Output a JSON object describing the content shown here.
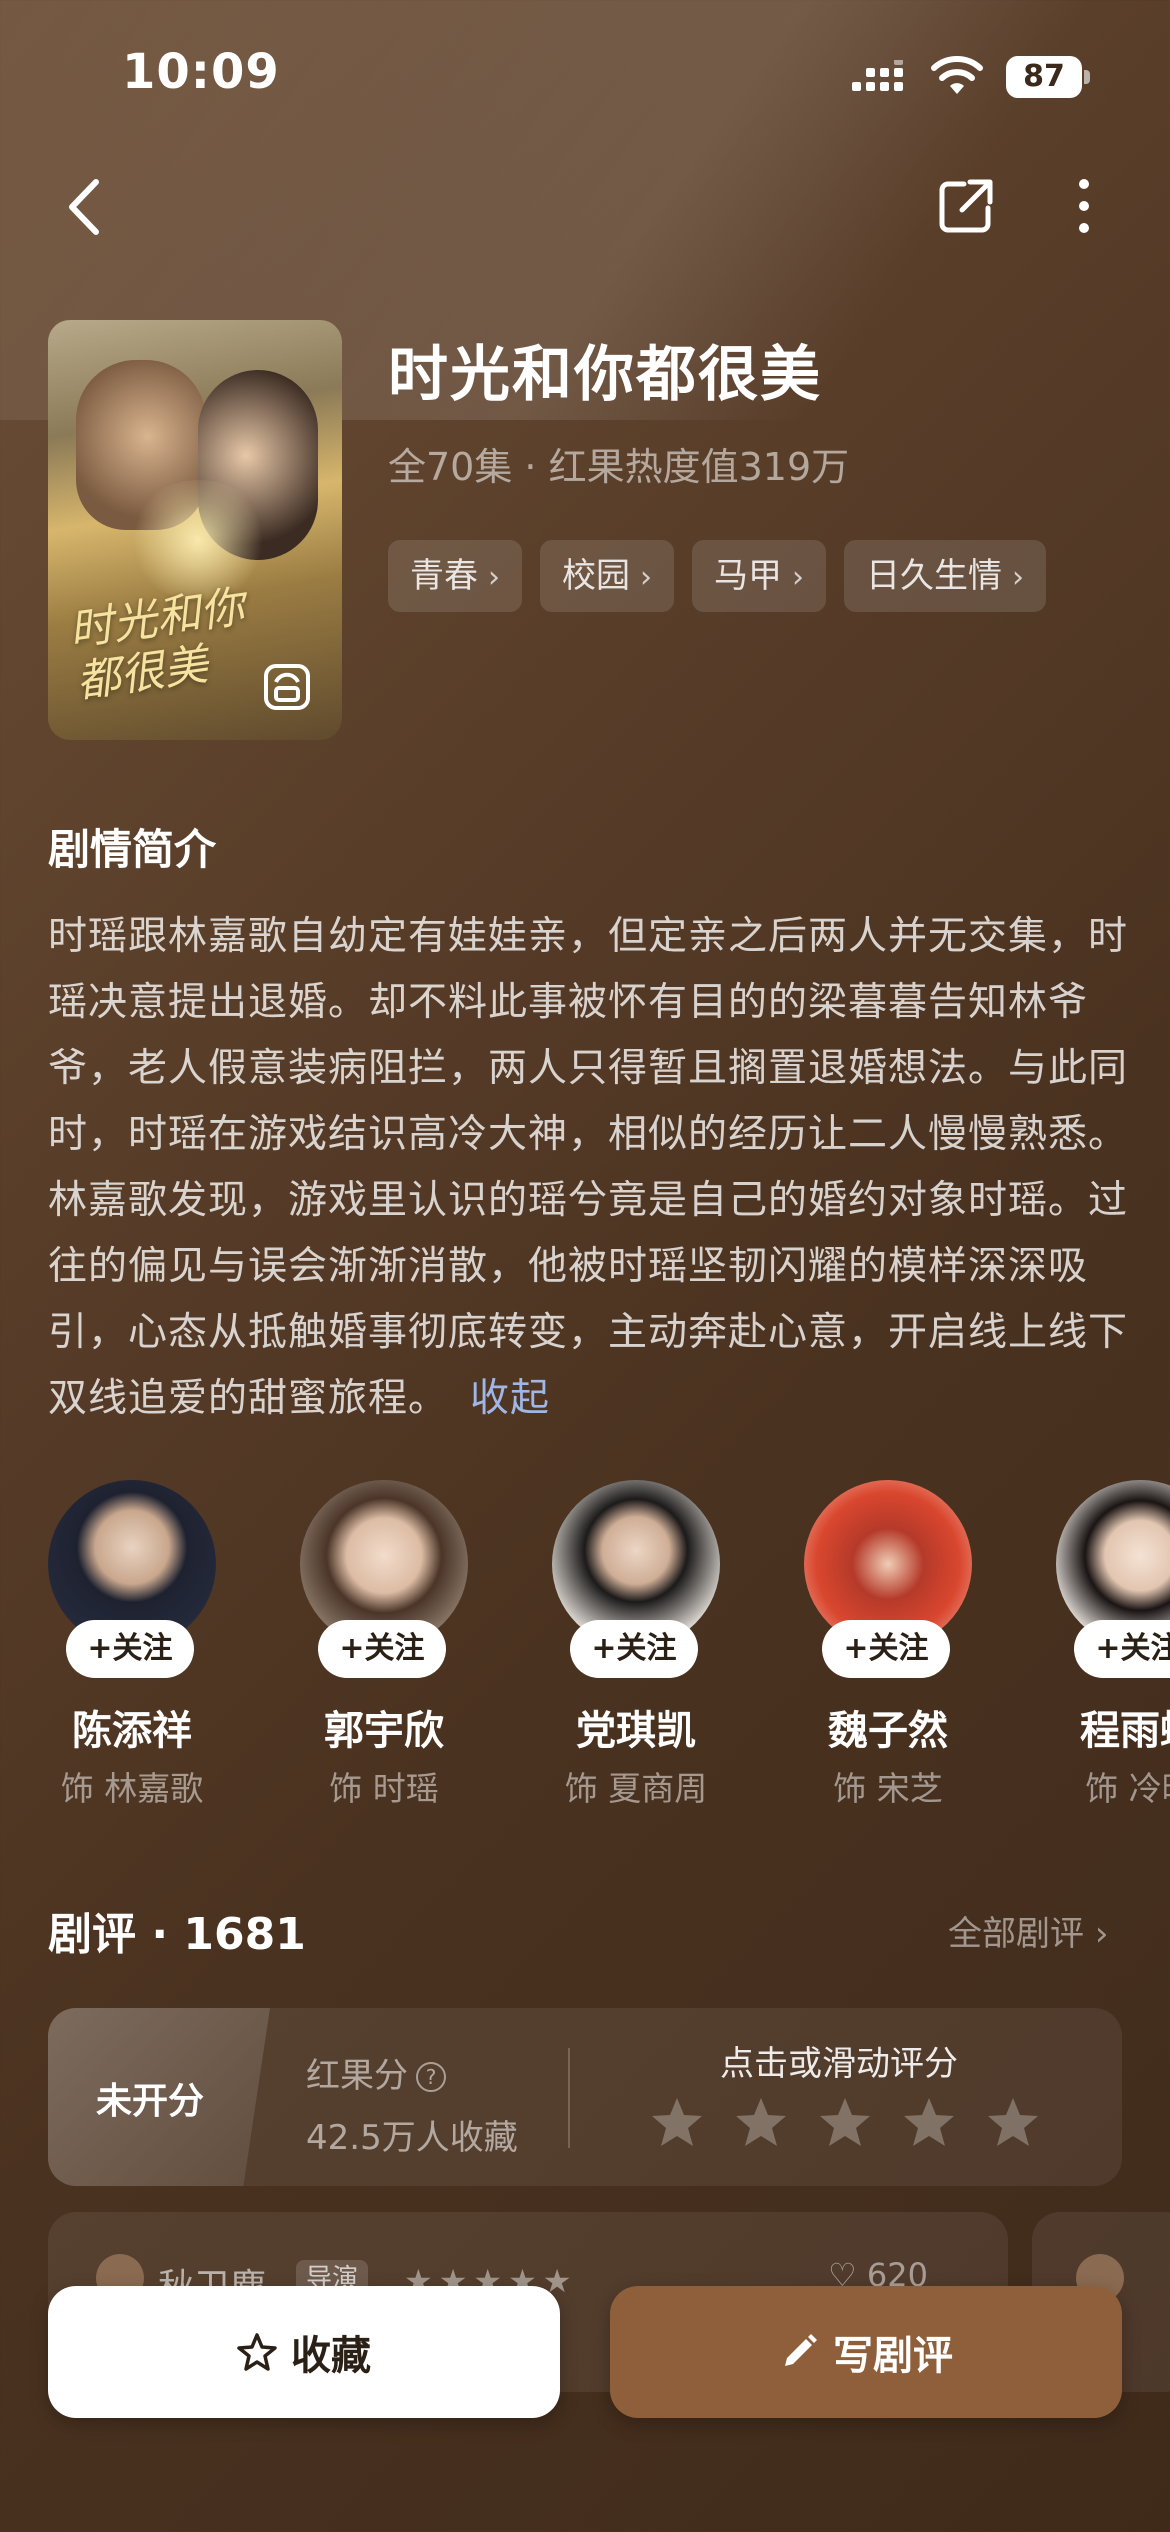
{
  "status_bar": {
    "time": "10:09",
    "battery": "87",
    "icons": [
      "cellular-signal-icon",
      "wifi-icon",
      "battery-icon"
    ]
  },
  "nav": {
    "icons": [
      "back-icon",
      "share-icon",
      "more-icon"
    ]
  },
  "drama": {
    "title": "时光和你都很美",
    "meta": "全70集 · 红果热度值319万",
    "poster_text": "时光和你\n都很美",
    "tags": [
      "青春",
      "校园",
      "马甲",
      "日久生情"
    ]
  },
  "synopsis": {
    "heading": "剧情简介",
    "text": "时瑶跟林嘉歌自幼定有娃娃亲，但定亲之后两人并无交集，时瑶决意提出退婚。却不料此事被怀有目的的梁暮暮告知林爷爷，老人假意装病阻拦，两人只得暂且搁置退婚想法。与此同时，时瑶在游戏结识高冷大神，相似的经历让二人慢慢熟悉。林嘉歌发现，游戏里认识的瑶兮竟是自己的婚约对象时瑶。过往的偏见与误会渐渐消散，他被时瑶坚韧闪耀的模样深深吸引，心态从抵触婚事彻底转变，主动奔赴心意，开启线上线下双线追爱的甜蜜旅程。",
    "collapse_label": "收起"
  },
  "cast": {
    "follow_label": "+关注",
    "members": [
      {
        "name": "陈添祥",
        "role": "饰 林嘉歌",
        "color": "#1e2230"
      },
      {
        "name": "郭宇欣",
        "role": "饰 时瑶",
        "color": "#c9b8a6"
      },
      {
        "name": "党琪凯",
        "role": "饰 夏商周",
        "color": "#d7d2cc"
      },
      {
        "name": "魏子然",
        "role": "饰 宋芝",
        "color": "#d9462e"
      },
      {
        "name": "程雨蝶",
        "role": "饰 冷晞",
        "color": "#e9e4de"
      }
    ]
  },
  "reviews": {
    "heading": "剧评 · 1681",
    "all_label": "全部剧评",
    "score": {
      "status": "未开分",
      "label": "红果分",
      "collections": "42.5万人收藏",
      "rate_hint": "点击或滑动评分",
      "stars_total": 5
    },
    "preview": {
      "user": "秋卫塵",
      "badge": "导演",
      "likes": "620"
    }
  },
  "bottom": {
    "favorite_label": "收藏",
    "write_label": "写剧评"
  }
}
